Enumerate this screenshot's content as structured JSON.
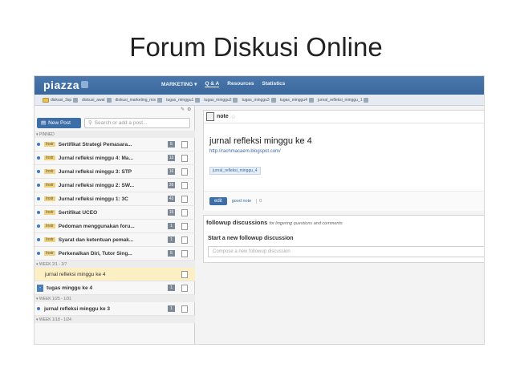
{
  "slide_title": "Forum Diskusi Online",
  "app": {
    "logo": "piazza",
    "nav": [
      "MARKETING ▾",
      "Q & A",
      "Resources",
      "Statistics"
    ]
  },
  "folders": [
    "diskusi_3sp",
    "diskusi_awal",
    "diskusi_marketing_mix",
    "tugas_minggu1",
    "tugas_minggu2",
    "tugas_minggu3",
    "tugas_minggu4",
    "jurnal_refleksi_minggu_1"
  ],
  "sidebar": {
    "new_post": "New Post",
    "search_placeholder": "Search or add a post...",
    "pinned_label": "▾ PINNED",
    "pinned": [
      {
        "tag": "Instr",
        "title": "Sertifikat Strategi Pemasara...",
        "count": "5"
      },
      {
        "tag": "Instr",
        "title": "Jurnal refleksi minggu 4: Ma...",
        "count": "13"
      },
      {
        "tag": "Instr",
        "title": "Jurnal refleksi minggu 3: STP",
        "count": "16"
      },
      {
        "tag": "Instr",
        "title": "Jurnal refleksi minggu 2: SW...",
        "count": "26"
      },
      {
        "tag": "Instr",
        "title": "Jurnal refleksi minggu 1: 3C",
        "count": "43"
      },
      {
        "tag": "Instr",
        "title": "Sertifikat UCEO",
        "count": "15"
      },
      {
        "tag": "Instr",
        "title": "Pedoman menggunakan foru...",
        "count": "1"
      },
      {
        "tag": "Instr",
        "title": "Syarat dan ketentuan pemak...",
        "count": "1"
      },
      {
        "tag": "Instr",
        "title": "Perkenalkan Diri, Tutor Sing...",
        "count": "5"
      }
    ],
    "week1_label": "▾ WEEK 2/1 - 2/7",
    "week1": [
      {
        "title": "jurnal refleksi minggu ke 4",
        "count": ""
      },
      {
        "title": "tugas minggu ke 4",
        "count": "1"
      }
    ],
    "week2_label": "▾ WEEK 1/25 - 1/31",
    "week2": [
      {
        "title": "jurnal refleksi minggu ke 3",
        "count": "1"
      }
    ],
    "week3_label": "▾ WEEK 1/18 - 1/24"
  },
  "note": {
    "header": "note",
    "title": "jurnal refleksi minggu ke 4",
    "link": "http://rachmacaem.blogspot.com/",
    "tag": "jurnal_refleksi_minggu_4",
    "edit": "edit",
    "good_note": "good note",
    "good_count": "0"
  },
  "followup": {
    "title": "followup discussions",
    "subtitle": "for lingering questions and comments",
    "start": "Start a new followup discussion",
    "placeholder": "Compose a new followup discussion"
  }
}
